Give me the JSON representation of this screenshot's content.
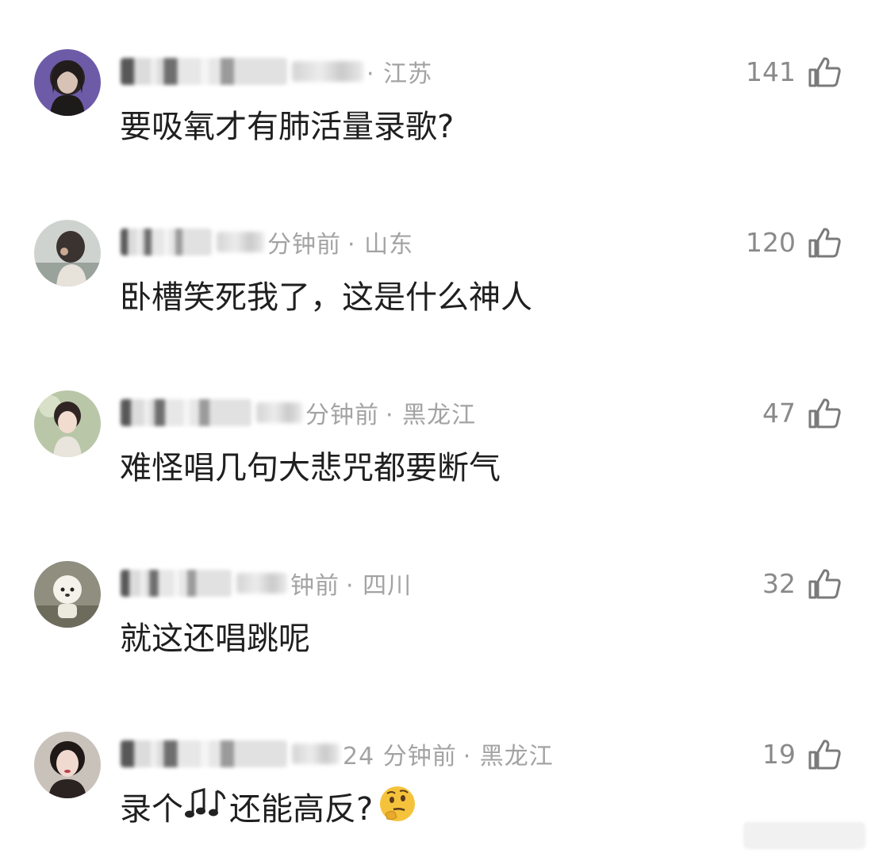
{
  "colors": {
    "meta": "#a3a3a3",
    "text": "#1f1f1f",
    "likes": "#8a8a8a",
    "background": "#ffffff"
  },
  "comments": [
    {
      "username_blurred": true,
      "time": "",
      "location_line": "· 江苏",
      "likes": "141",
      "text": "要吸氧才有肺活量录歌?",
      "avatar_icon": "dark-hair-girl-avatar"
    },
    {
      "username_blurred": true,
      "time": "分钟前",
      "location_line": "· 山东",
      "likes": "120",
      "text": "卧槽笑死我了，这是什么神人",
      "avatar_icon": "back-view-girl-avatar"
    },
    {
      "username_blurred": true,
      "time": "分钟前",
      "location_line": "· 黑龙江",
      "likes": "47",
      "text": "难怪唱几句大悲咒都要断气",
      "avatar_icon": "illustrated-girl-avatar"
    },
    {
      "username_blurred": true,
      "time": "钟前",
      "location_line": "· 四川",
      "likes": "32",
      "text": "就这还唱跳呢",
      "avatar_icon": "white-dog-plush-avatar"
    },
    {
      "username_blurred": true,
      "time": "24 分钟前",
      "location_line": "· 黑龙江",
      "likes": "19",
      "text_before": "录个",
      "text_after": "还能高反?",
      "avatar_icon": "woman-portrait-avatar"
    }
  ]
}
